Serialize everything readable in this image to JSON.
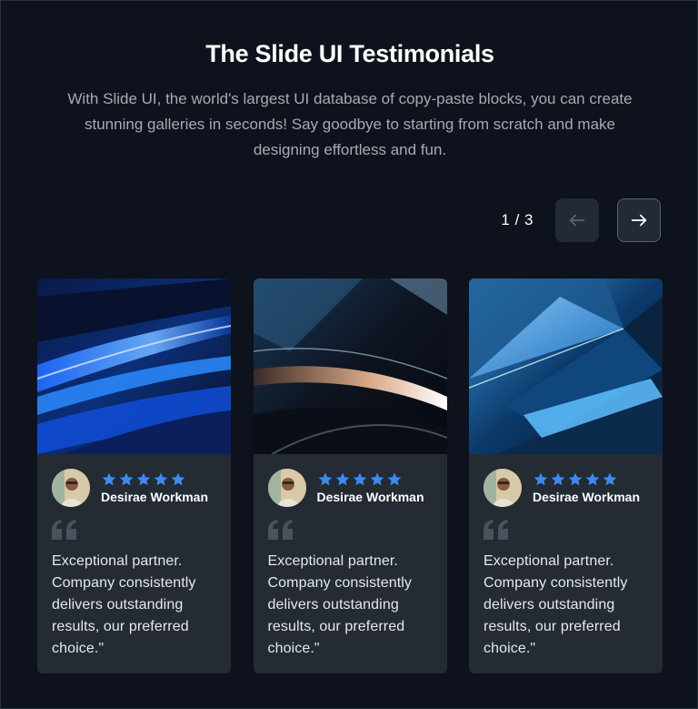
{
  "header": {
    "title": "The Slide UI Testimonials",
    "subtitle": "With Slide UI, the world's largest UI database of copy-paste blocks, you can create stunning galleries in seconds! Say goodbye to starting from scratch and make designing effortless and fun."
  },
  "pager": {
    "count": "1 / 3",
    "prev_icon": "arrow-left-icon",
    "next_icon": "arrow-right-icon"
  },
  "colors": {
    "background": "#0d121c",
    "card": "#242b33",
    "star": "#3b8bf0"
  },
  "testimonials": [
    {
      "name": "Desirae Workman",
      "rating": 5,
      "quote": "Exceptional partner. Company consistently delivers outstanding results, our preferred choice.\""
    },
    {
      "name": "Desirae Workman",
      "rating": 5,
      "quote": "Exceptional partner. Company consistently delivers outstanding results, our preferred choice.\""
    },
    {
      "name": "Desirae Workman",
      "rating": 5,
      "quote": "Exceptional partner. Company consistently delivers outstanding results, our preferred choice.\""
    }
  ]
}
